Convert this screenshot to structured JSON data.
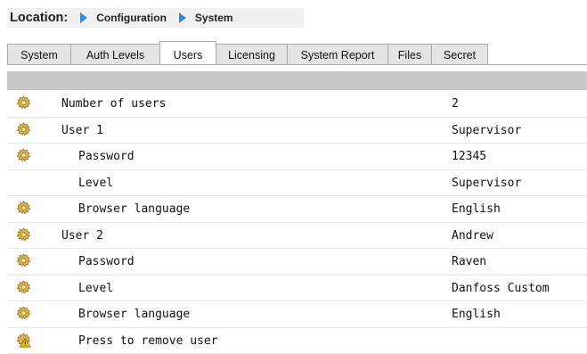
{
  "location": {
    "label": "Location:",
    "crumbs": [
      "Configuration",
      "System"
    ]
  },
  "tabs": [
    {
      "label": "System",
      "active": false
    },
    {
      "label": "Auth Levels",
      "active": false
    },
    {
      "label": "Users",
      "active": true
    },
    {
      "label": "Licensing",
      "active": false
    },
    {
      "label": "System Report",
      "active": false
    },
    {
      "label": "Files",
      "active": false
    },
    {
      "label": "Secret",
      "active": false
    }
  ],
  "rows": [
    {
      "label": "Number of users",
      "value": "2",
      "icon": "gear-icon",
      "indent": false
    },
    {
      "label": "User 1",
      "value": "Supervisor",
      "icon": "gear-icon",
      "indent": false
    },
    {
      "label": "Password",
      "value": "12345",
      "icon": "gear-icon",
      "indent": true
    },
    {
      "label": "Level",
      "value": "Supervisor",
      "icon": "",
      "indent": true
    },
    {
      "label": "Browser language",
      "value": "English",
      "icon": "gear-icon",
      "indent": true
    },
    {
      "label": "User 2",
      "value": "Andrew",
      "icon": "gear-icon",
      "indent": false
    },
    {
      "label": "Password",
      "value": "Raven",
      "icon": "gear-icon",
      "indent": true
    },
    {
      "label": "Level",
      "value": "Danfoss Custom",
      "icon": "gear-icon",
      "indent": true
    },
    {
      "label": "Browser language",
      "value": "English",
      "icon": "gear-icon",
      "indent": true
    },
    {
      "label": "Press to remove user",
      "value": "",
      "icon": "warning-gear-icon",
      "indent": true
    }
  ],
  "colors": {
    "accent_arrow": "#3a86d9",
    "tab_bg": "#e4e4e4",
    "header_strip": "#c8c8c8",
    "gear_gold": "#d9b24a"
  }
}
